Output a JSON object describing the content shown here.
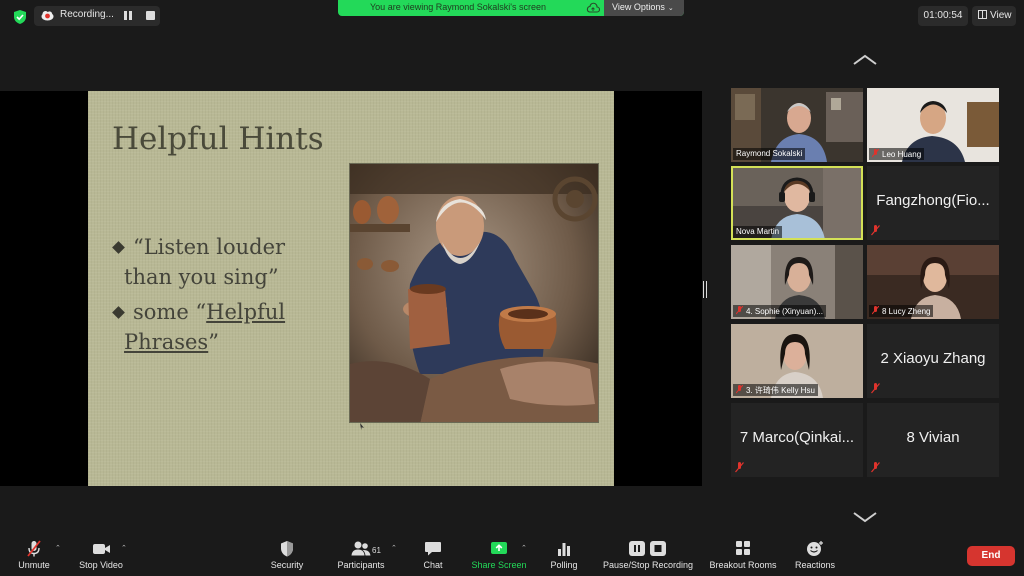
{
  "recording": {
    "label": "Recording..."
  },
  "banner": {
    "text": "You are viewing Raymond Sokalski's screen",
    "view_options": "View Options"
  },
  "timer": {
    "value": "01:00:54"
  },
  "view_button": {
    "label": "View"
  },
  "slide": {
    "title": "Helpful Hints",
    "bullet1_line1": "“Listen louder",
    "bullet1_line2": "than you sing”",
    "bullet2_prefix": "some “",
    "bullet2_link1": "Helpful",
    "bullet2_link2": "Phrases",
    "bullet2_suffix": "”"
  },
  "gallery": {
    "participants": [
      {
        "label": "Raymond Sokalski",
        "muted": false,
        "video": true
      },
      {
        "label": "Leo Huang",
        "muted": true,
        "video": true
      },
      {
        "label": "Nova Martin",
        "muted": false,
        "video": true,
        "active_speaker": true
      },
      {
        "big_name": "Fangzhong(Fio...",
        "muted": true,
        "video": false
      },
      {
        "label": "4. Sophie (Xinyuan)...",
        "muted": true,
        "video": true
      },
      {
        "label": "8 Lucy Zheng",
        "muted": true,
        "video": true
      },
      {
        "label": "3. 许琦伟 Kelly Hsu",
        "muted": true,
        "video": true
      },
      {
        "big_name": "2 Xiaoyu Zhang",
        "muted": true,
        "video": false
      },
      {
        "big_name": "7 Marco(Qinkai...",
        "muted": true,
        "video": false
      },
      {
        "big_name": "8 Vivian",
        "muted": true,
        "video": false
      }
    ]
  },
  "toolbar": {
    "unmute": "Unmute",
    "stop_video": "Stop Video",
    "security": "Security",
    "participants": "Participants",
    "participants_count": "61",
    "chat": "Chat",
    "share_screen": "Share Screen",
    "polling": "Polling",
    "pause_stop_recording": "Pause/Stop Recording",
    "breakout_rooms": "Breakout Rooms",
    "reactions": "Reactions",
    "end": "End"
  },
  "colors": {
    "share_green": "#23d959",
    "end_red": "#d6352f",
    "active_speaker": "#d4e157",
    "mic_off_red": "#e0332c"
  }
}
